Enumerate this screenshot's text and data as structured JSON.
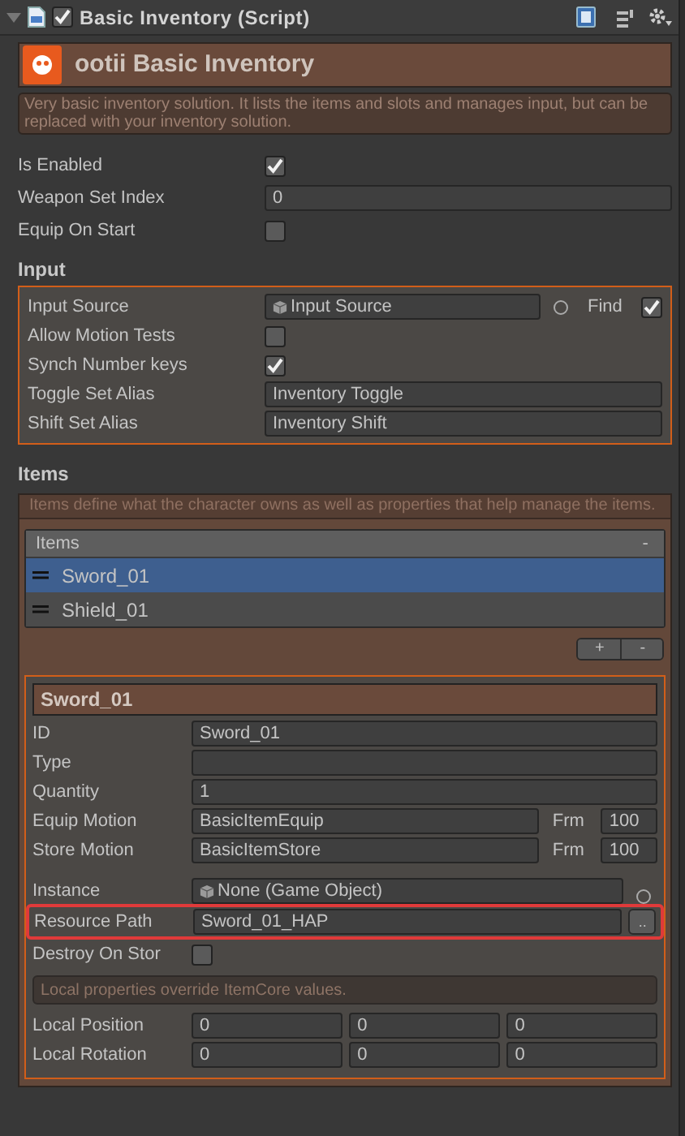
{
  "header": {
    "title": "Basic Inventory (Script)",
    "enabled": true,
    "expanded": true
  },
  "banner": {
    "title": "ootii Basic Inventory",
    "description": "Very basic inventory solution. It lists the items and slots and manages input, but can be replaced with your inventory solution."
  },
  "fields": [
    {
      "kind": "checkbox",
      "label": "Is Enabled",
      "checked": true
    },
    {
      "kind": "text",
      "label": "Weapon Set Index",
      "value": "0"
    },
    {
      "kind": "checkbox",
      "label": "Equip On Start",
      "checked": false
    }
  ],
  "input": {
    "heading": "Input",
    "rows": [
      {
        "kind": "object",
        "label": "Input Source",
        "value": "Input Source",
        "find_label": "Find",
        "find_checked": true
      },
      {
        "kind": "checkbox",
        "label": "Allow Motion Tests",
        "checked": false
      },
      {
        "kind": "checkbox",
        "label": "Synch Number keys",
        "checked": true
      },
      {
        "kind": "text",
        "label": "Toggle Set Alias",
        "value": "Inventory Toggle"
      },
      {
        "kind": "text",
        "label": "Shift Set Alias",
        "value": "Inventory Shift"
      }
    ]
  },
  "items": {
    "heading": "Items",
    "description": "Items define what the character owns as well as properties that help manage the items.",
    "list": {
      "header": "Items",
      "header_button": "-",
      "entries": [
        {
          "label": "Sword_01",
          "selected": true
        },
        {
          "label": "Shield_01",
          "selected": false
        }
      ]
    },
    "buttons": [
      "+",
      "-"
    ],
    "detail": {
      "title": "Sword_01",
      "rows": [
        {
          "kind": "text",
          "label": "ID",
          "value": "Sword_01"
        },
        {
          "kind": "text",
          "label": "Type"
        },
        {
          "kind": "text",
          "label": "Quantity",
          "value": "1"
        },
        {
          "kind": "motion",
          "label": "Equip Motion",
          "value": "BasicItemEquip",
          "frame_label": "Frm",
          "frames": "100"
        },
        {
          "kind": "motion",
          "label": "Store Motion",
          "value": "BasicItemStore",
          "frame_label": "Frm",
          "frames": "100"
        },
        {
          "kind": "object",
          "label": "Instance",
          "value": "None (Game Object)"
        },
        {
          "kind": "path",
          "label": "Resource Path",
          "value": "Sword_01_HAP",
          "button": "..",
          "highlighted": true
        },
        {
          "kind": "checkbox",
          "label": "Destroy On Stor",
          "checked": false
        },
        {
          "kind": "note",
          "text": "Local properties override ItemCore values."
        },
        {
          "kind": "vector",
          "label": "Local Position",
          "values": [
            "0",
            "0",
            "0"
          ]
        },
        {
          "kind": "vector",
          "label": "Local Rotation",
          "values": [
            "0",
            "0",
            "0"
          ]
        }
      ]
    }
  }
}
